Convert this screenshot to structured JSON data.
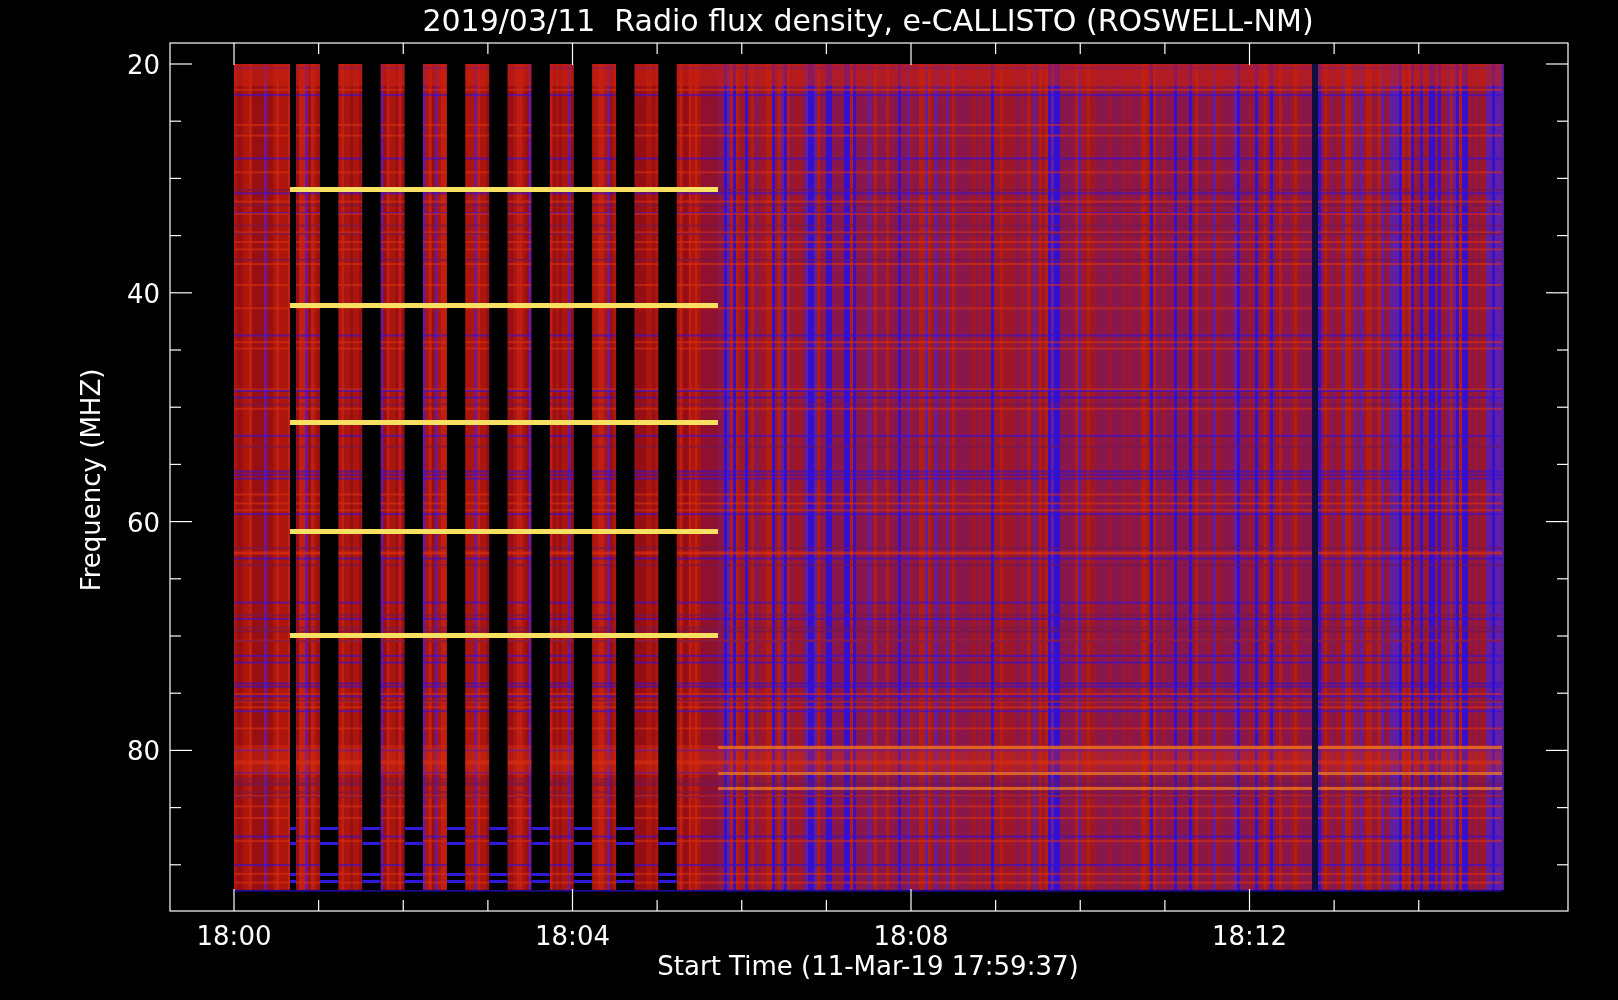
{
  "title": "2019/03/11  Radio flux density, e-CALLISTO (ROSWELL-NM)",
  "y_axis": {
    "label": "Frequency (MHZ)",
    "ticks": [
      "20",
      "40",
      "60",
      "80"
    ]
  },
  "x_axis": {
    "label": "Start Time (11-Mar-19 17:59:37)",
    "ticks": [
      "18:00",
      "18:04",
      "18:08",
      "18:12"
    ]
  }
}
